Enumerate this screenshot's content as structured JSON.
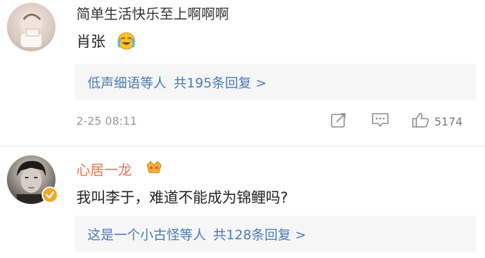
{
  "comments": [
    {
      "username": "简单生活快乐至上啊啊啊",
      "text": "肖张",
      "replies": {
        "names": "低声细语等人",
        "count": "共195条回复 >"
      },
      "time": "2-25 08:11",
      "likes": "5174",
      "icons": {
        "emoji": "crying-laugh-emoji-icon",
        "share": "share-icon",
        "comment": "comment-icon",
        "like": "thumbs-up-icon"
      }
    },
    {
      "username": "心居一龙",
      "text": "我叫李于，难道不能成为锦鲤吗?",
      "replies": {
        "names": "这是一个小古怪等人",
        "count": "共128条回复 >"
      },
      "icons": {
        "vip": "vip-crown-icon",
        "badge": "verified-badge-icon"
      }
    }
  ],
  "colors": {
    "username_highlight": "#eb7350",
    "link": "#4a7bb6",
    "reply_bg": "#f6f6f6",
    "meta": "#999999"
  }
}
